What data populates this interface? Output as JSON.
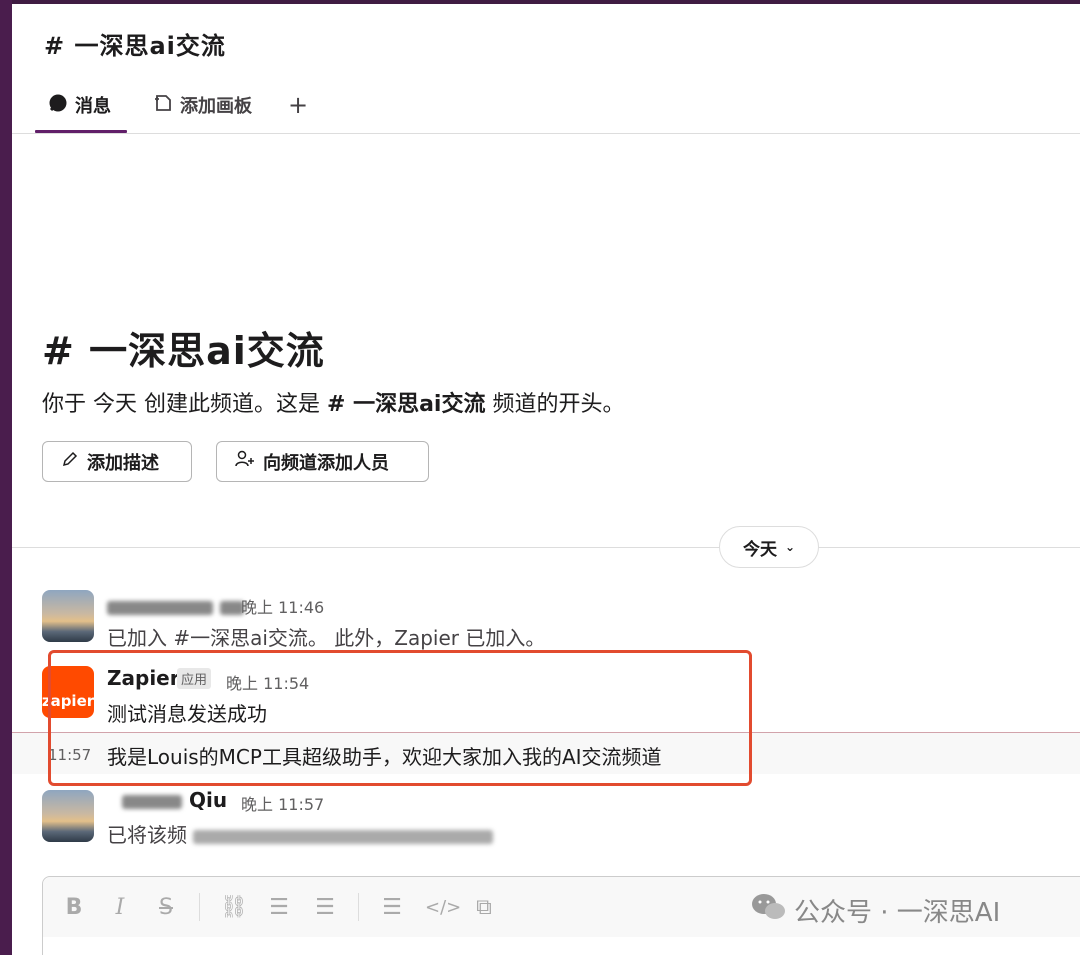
{
  "header": {
    "title": "# 一深思ai交流"
  },
  "tabs": [
    {
      "label": "消息",
      "icon": "message-icon"
    },
    {
      "label": "添加画板",
      "icon": "canvas-icon"
    },
    {
      "label": "+",
      "icon": "plus-icon"
    }
  ],
  "intro": {
    "title": "# 一深思ai交流",
    "desc_prefix": "你于 今天 创建此频道。这是 ",
    "desc_channel": "# 一深思ai交流",
    "desc_suffix": " 频道的开头。",
    "btn_desc": "添加描述",
    "btn_add": "向频道添加人员"
  },
  "day_divider": {
    "label": "今天"
  },
  "messages": [
    {
      "sender": "",
      "time": "晚上 11:46",
      "text": "已加入 #一深思ai交流。 此外，Zapier 已加入。"
    },
    {
      "sender": "Zapier",
      "badge": "应用",
      "time": "晚上 11:54",
      "text": "测试消息发送成功",
      "avatar_label": "zapier"
    },
    {
      "time": "11:57",
      "text": "我是Louis的MCP工具超级助手，欢迎大家加入我的AI交流频道"
    },
    {
      "sender": "Qiu",
      "time": "晚上 11:57",
      "text": "已将该频"
    }
  ],
  "watermark": {
    "text": "公众号 · 一深思AI"
  },
  "colors": {
    "accent": "#611f69",
    "zapier": "#ff4a00",
    "highlight": "#e24b2f"
  }
}
